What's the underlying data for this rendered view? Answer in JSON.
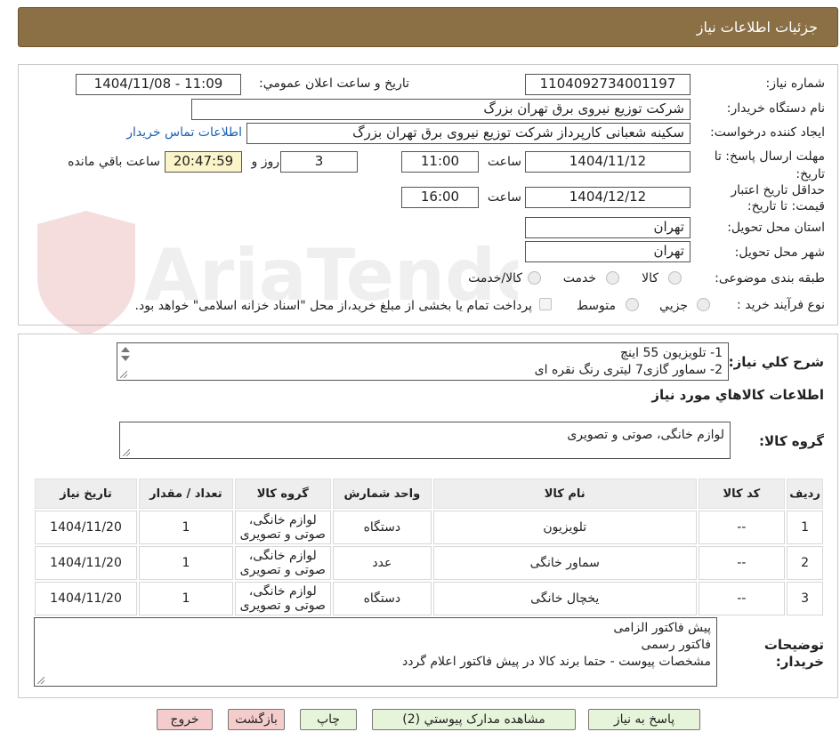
{
  "header": {
    "title": "جزئیات اطلاعات نیاز"
  },
  "form": {
    "need_number_label": "شماره نیاز:",
    "need_number": "1104092734001197",
    "announce_label": "تاریخ و ساعت اعلان عمومي:",
    "announce_value": "1404/11/08 - 11:09",
    "buyer_org_label": "نام دستگاه خریدار:",
    "buyer_org": "شرکت توزیع نیروی برق تهران بزرگ",
    "requester_label": "ایجاد کننده درخواست:",
    "requester": "سکینه شعبانی کارپرداز شرکت توزیع نیروی برق تهران بزرگ",
    "contact_link": "اطلاعات تماس خریدار",
    "deadline_label_1": "مهلت ارسال پاسخ: تا",
    "deadline_label_2": "تاریخ:",
    "deadline_date": "1404/11/12",
    "time_label": "ساعت",
    "deadline_time": "11:00",
    "days": "3",
    "days_label": "روز و",
    "remaining_time": "20:47:59",
    "remaining_label": "ساعت باقي مانده",
    "validity_label_1": "حداقل تاریخ اعتبار",
    "validity_label_2": "قیمت: تا تاریخ:",
    "validity_date": "1404/12/12",
    "validity_time": "16:00",
    "province_label": "استان محل تحویل:",
    "province": "تهران",
    "city_label": "شهر محل تحویل:",
    "city": "تهران",
    "category_label": "طبقه بندی موضوعی:",
    "category_options": [
      "کالا",
      "خدمت",
      "کالا/خدمت"
    ],
    "purchase_type_label": "نوع فرآیند خرید :",
    "purchase_options": [
      "جزیي",
      "متوسط"
    ],
    "purchase_note": "پرداخت تمام یا بخشی از مبلغ خرید،از محل \"اسناد خزانه اسلامی\" خواهد بود."
  },
  "summary": {
    "label": "شرح کلي نیاز:",
    "lines": [
      "1- تلویزیون 55 اینچ",
      "2- سماور گازی7 لیتری رنگ نقره ای"
    ]
  },
  "goods": {
    "section_title": "اطلاعات کالاهاي مورد نیاز",
    "group_label": "گروه کالا:",
    "group_value": "لوازم خانگی، صوتی و تصویری",
    "columns": [
      "ردیف",
      "کد کالا",
      "نام کالا",
      "واحد شمارش",
      "گروه کالا",
      "تعداد / مقدار",
      "تاریخ نیاز"
    ],
    "rows": [
      {
        "idx": "1",
        "code": "--",
        "name": "تلویزیون",
        "unit": "دستگاه",
        "group_1": "لوازم خانگی،",
        "group_2": "صوتی و تصویری",
        "qty": "1",
        "date": "1404/11/20"
      },
      {
        "idx": "2",
        "code": "--",
        "name": "سماور خانگی",
        "unit": "عدد",
        "group_1": "لوازم خانگی،",
        "group_2": "صوتی و تصویری",
        "qty": "1",
        "date": "1404/11/20"
      },
      {
        "idx": "3",
        "code": "--",
        "name": "یخچال خانگی",
        "unit": "دستگاه",
        "group_1": "لوازم خانگی،",
        "group_2": "صوتی و تصویری",
        "qty": "1",
        "date": "1404/11/20"
      }
    ]
  },
  "notes": {
    "label_1": "توضیحات",
    "label_2": "خریدار:",
    "lines": [
      "پیش فاکتور الزامی",
      "فاکتور رسمی",
      "مشخصات پیوست - حتما برند کالا در پیش فاکتور اعلام گردد"
    ]
  },
  "buttons": {
    "reply": "پاسخ به نیاز",
    "attachments": "مشاهده مدارک پیوستي (2)",
    "print": "چاپ",
    "back": "بازگشت",
    "exit": "خروج"
  },
  "watermark": {
    "text": "AriaTender.neT"
  },
  "colors": {
    "header_bg": "#8b6f45",
    "link": "#1a5fb4",
    "highlight": "#fbf4c9",
    "button_green": "#e6f4da",
    "button_pink": "#f4cccc"
  }
}
